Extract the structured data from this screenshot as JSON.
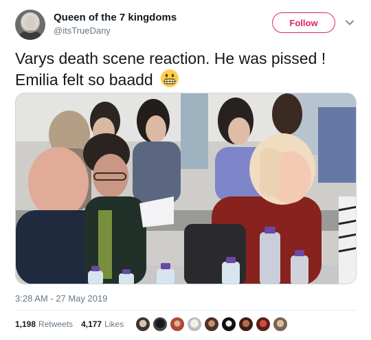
{
  "author": {
    "name": "Queen of the 7 kingdoms",
    "handle": "@itsTrueDany",
    "avatar_icon": "profile-photo"
  },
  "follow_label": "Follow",
  "menu_icon": "chevron-down-icon",
  "tweet": {
    "text_line1": "Varys death scene reaction. He was pissed !",
    "text_line2": "Emilia felt so baadd",
    "emoji": "grimacing-face"
  },
  "media": {
    "kind": "photo",
    "subject": "cast table read"
  },
  "timestamp": "3:28 AM - 27 May 2019",
  "stats": {
    "retweets_count": "1,198",
    "retweets_label": "Retweets",
    "likes_count": "4,177",
    "likes_label": "Likes"
  },
  "likers_count": 9,
  "colors": {
    "follow_accent": "#e0245e",
    "secondary_text": "#657786",
    "primary_text": "#14171a",
    "divider": "#e6ecf0"
  }
}
